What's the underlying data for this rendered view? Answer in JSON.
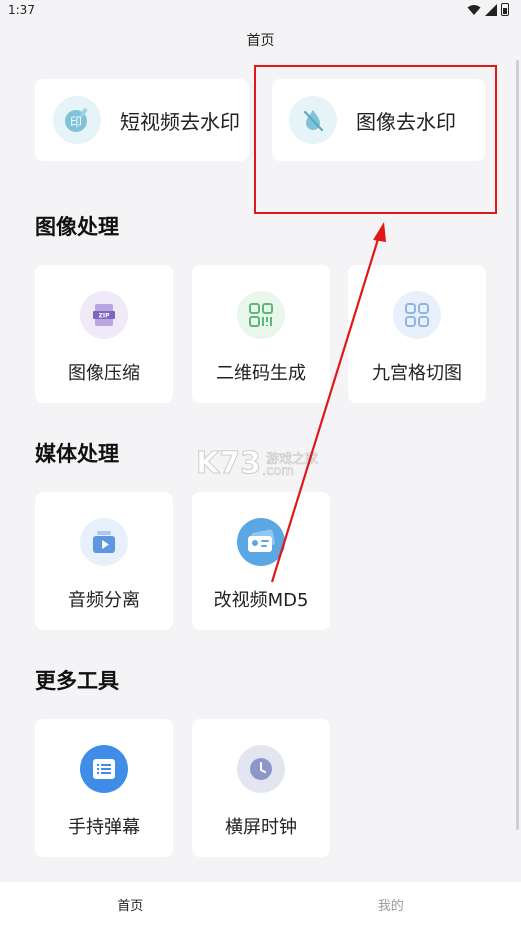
{
  "status_bar": {
    "time": "1:37"
  },
  "header": {
    "title": "首页"
  },
  "top_cards": [
    {
      "label": "短视频去水印",
      "icon": "stamp-print-icon"
    },
    {
      "label": "图像去水印",
      "icon": "droplet-slash-icon"
    }
  ],
  "sections": [
    {
      "title": "图像处理",
      "items": [
        {
          "label": "图像压缩",
          "icon": "zip-file-icon"
        },
        {
          "label": "二维码生成",
          "icon": "qr-code-icon"
        },
        {
          "label": "九宫格切图",
          "icon": "grid-icon"
        }
      ]
    },
    {
      "title": "媒体处理",
      "items": [
        {
          "label": "音频分离",
          "icon": "video-play-icon"
        },
        {
          "label": "改视频MD5",
          "icon": "id-card-icon"
        }
      ]
    },
    {
      "title": "更多工具",
      "items": [
        {
          "label": "手持弹幕",
          "icon": "text-lines-icon"
        },
        {
          "label": "横屏时钟",
          "icon": "clock-icon"
        }
      ]
    }
  ],
  "watermark": {
    "main": "K73",
    "sub": "游戏之家",
    "domain": ".com"
  },
  "bottom_nav": [
    {
      "label": "首页",
      "active": true
    },
    {
      "label": "我的",
      "active": false
    }
  ],
  "colors": {
    "highlight": "#e01818",
    "nav_active": "#222222",
    "nav_inactive": "#999999"
  }
}
